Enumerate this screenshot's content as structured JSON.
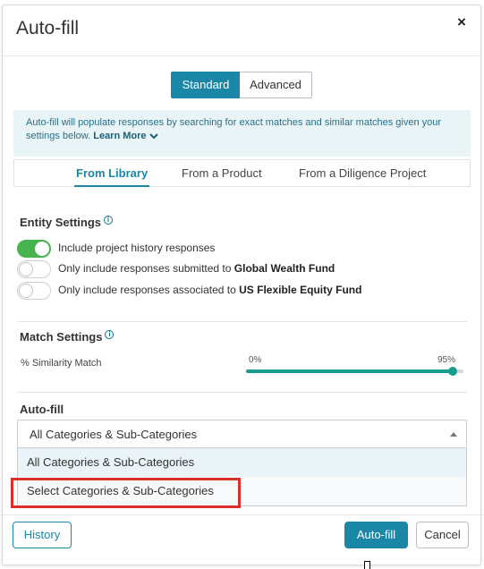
{
  "dialog": {
    "title": "Auto-fill",
    "close_label": "×"
  },
  "mode_toggle": {
    "standard": "Standard",
    "advanced": "Advanced",
    "selected": "Standard"
  },
  "info": {
    "text": "Auto-fill will populate responses by searching for exact matches and similar matches given your settings below.",
    "learn_more": "Learn More"
  },
  "tabs": [
    {
      "label": "From Library",
      "active": true
    },
    {
      "label": "From a Product",
      "active": false
    },
    {
      "label": "From a Diligence Project",
      "active": false
    }
  ],
  "entity_settings": {
    "title": "Entity Settings",
    "toggles": [
      {
        "label": "Include project history responses",
        "bold": "",
        "on": true
      },
      {
        "label": "Only include responses submitted to ",
        "bold": "Global Wealth Fund",
        "on": false
      },
      {
        "label": "Only include responses associated to ",
        "bold": "US Flexible Equity Fund",
        "on": false
      }
    ]
  },
  "match_settings": {
    "title": "Match Settings",
    "similarity_label": "% Similarity Match",
    "min_label": "0%",
    "value_label": "95%",
    "value": 95
  },
  "autofill": {
    "title": "Auto-fill",
    "selected": "All Categories & Sub-Categories",
    "options": [
      "All Categories & Sub-Categories",
      "Select Categories & Sub-Categories"
    ]
  },
  "footer": {
    "history": "History",
    "autofill": "Auto-fill",
    "cancel": "Cancel"
  },
  "colors": {
    "primary": "#1a87a6",
    "toggle_on": "#47b34f",
    "slider": "#1a9c8c",
    "highlight": "#d9302b"
  }
}
